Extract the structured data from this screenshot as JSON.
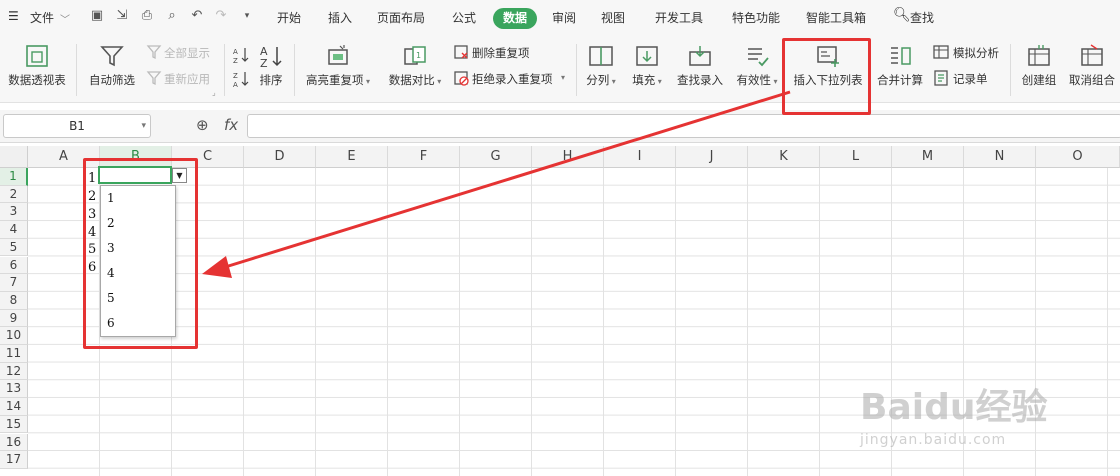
{
  "menubar": {
    "file_label": "文件",
    "tabs": [
      "开始",
      "插入",
      "页面布局",
      "公式",
      "数据",
      "审阅",
      "视图",
      "开发工具",
      "特色功能",
      "智能工具箱"
    ],
    "active_tab": "数据",
    "search_label": "查找"
  },
  "ribbon": {
    "pivot_table": "数据透视表",
    "auto_filter": "自动筛选",
    "show_all": "全部显示",
    "reapply": "重新应用",
    "sort": "排序",
    "highlight_duplicates": "高亮重复项",
    "data_compare": "数据对比",
    "remove_duplicates": "删除重复项",
    "reject_duplicates": "拒绝录入重复项",
    "split": "分列",
    "fill": "填充",
    "lookup_entry": "查找录入",
    "validity": "有效性",
    "insert_dropdown": "插入下拉列表",
    "merge_calc": "合并计算",
    "what_if": "模拟分析",
    "record_form": "记录单",
    "group": "创建组",
    "ungroup": "取消组合"
  },
  "formula_bar": {
    "name_box": "B1",
    "fx": "fx"
  },
  "sheet": {
    "columns": [
      "A",
      "B",
      "C",
      "D",
      "E",
      "F",
      "G",
      "H",
      "I",
      "J",
      "K",
      "L",
      "M",
      "N",
      "O"
    ],
    "rows": [
      "1",
      "2",
      "3",
      "4",
      "5",
      "6",
      "7",
      "8",
      "9",
      "10",
      "11",
      "12",
      "13",
      "14",
      "15",
      "16",
      "17"
    ],
    "column_a_values": [
      "1",
      "2",
      "3",
      "4",
      "5",
      "6"
    ],
    "selected_cell": "B1"
  },
  "dropdown": {
    "options": [
      "1",
      "2",
      "3",
      "4",
      "5",
      "6"
    ]
  },
  "colors": {
    "accent": "#3aa55d",
    "annotation": "#e53333"
  },
  "watermark": {
    "brand": "Baidu经验",
    "url": "jingyan.baidu.com"
  }
}
